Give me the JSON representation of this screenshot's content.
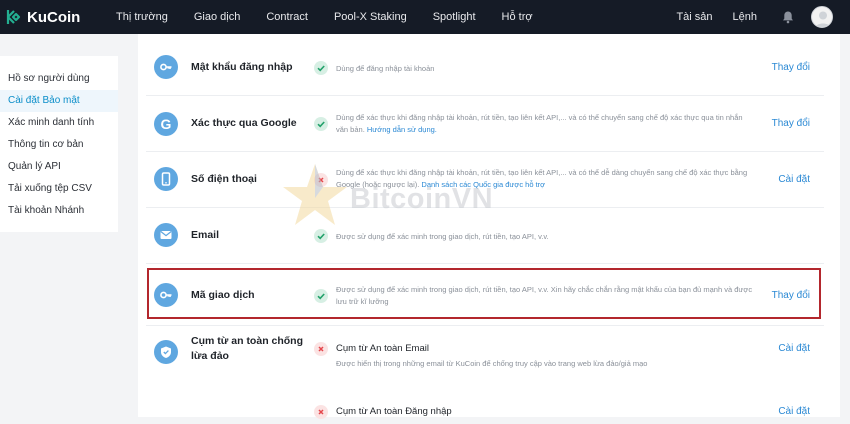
{
  "brand": {
    "name": "KuCoin"
  },
  "nav": {
    "items": [
      "Thị trường",
      "Giao dịch",
      "Contract",
      "Pool-X Staking",
      "Spotlight",
      "Hỗ trợ"
    ],
    "right": [
      "Tài sản",
      "Lệnh"
    ],
    "icons": [
      "bell-icon",
      "avatar"
    ]
  },
  "sidebar": {
    "items": [
      {
        "label": "Hồ sơ người dùng",
        "active": false
      },
      {
        "label": "Cài đặt Bảo mật",
        "active": true
      },
      {
        "label": "Xác minh danh tính",
        "active": false
      },
      {
        "label": "Thông tin cơ bản",
        "active": false
      },
      {
        "label": "Quản lý API",
        "active": false
      },
      {
        "label": "Tải xuống tệp CSV",
        "active": false
      },
      {
        "label": "Tài khoản Nhánh",
        "active": false
      }
    ]
  },
  "security": {
    "rows": [
      {
        "icon": "key-icon",
        "title": "Mật khẩu đăng nhập",
        "status": "ok",
        "desc": "Dùng để đăng nhập tài khoản",
        "link": "",
        "action": "Thay đổi"
      },
      {
        "icon": "google-icon",
        "title": "Xác thực qua Google",
        "status": "ok",
        "desc": "Dùng để xác thực khi đăng nhập tài khoản, rút tiền, tạo liên kết API,... và có thể chuyển sang chế độ xác thực qua tin nhắn văn bản.",
        "link": "Hướng dẫn sử dụng.",
        "action": "Thay đổi"
      },
      {
        "icon": "phone-icon",
        "title": "Số điện thoại",
        "status": "no",
        "desc": "Dùng để xác thực khi đăng nhập tài khoản, rút tiền, tạo liên kết API,... và có thể dễ dàng chuyển sang chế độ xác thực bằng Google (hoặc ngược lại).",
        "link": "Danh sách các Quốc gia được hỗ trợ",
        "action": "Cài đặt"
      },
      {
        "icon": "email-icon",
        "title": "Email",
        "status": "ok",
        "desc": "Được sử dụng để xác minh trong giao dịch, rút tiền, tạo API, v.v.",
        "link": "",
        "action": ""
      },
      {
        "icon": "key-icon",
        "title": "Mã giao dịch",
        "status": "ok",
        "desc": "Được sử dụng để xác minh trong giao dịch, rút tiền, tạo API, v.v. Xin hãy chắc chắn rằng mật khẩu của bạn đủ mạnh và được lưu trữ kĩ lưỡng",
        "link": "",
        "action": "Thay đổi"
      },
      {
        "icon": "shield-icon",
        "title": "Cụm từ an toàn chống lừa đảo",
        "status": "no",
        "sub": "Cụm từ An toàn Email",
        "desc": "Được hiển thị trong những email từ KuCoin để chống truy cập vào trang web lừa đảo/giả mạo",
        "link": "",
        "action": "Cài đặt"
      },
      {
        "icon": "",
        "title": "",
        "status": "no",
        "sub": "Cụm từ An toàn Đăng nhập",
        "desc": "",
        "link": "",
        "action": "Cài đặt"
      }
    ]
  },
  "watermark": {
    "text": "BitcoinVN"
  },
  "colors": {
    "topbar": "#151b26",
    "accent": "#2b89d4",
    "ok": "#23a26b",
    "fail": "#e5484d",
    "highlight": "#b3272d"
  }
}
